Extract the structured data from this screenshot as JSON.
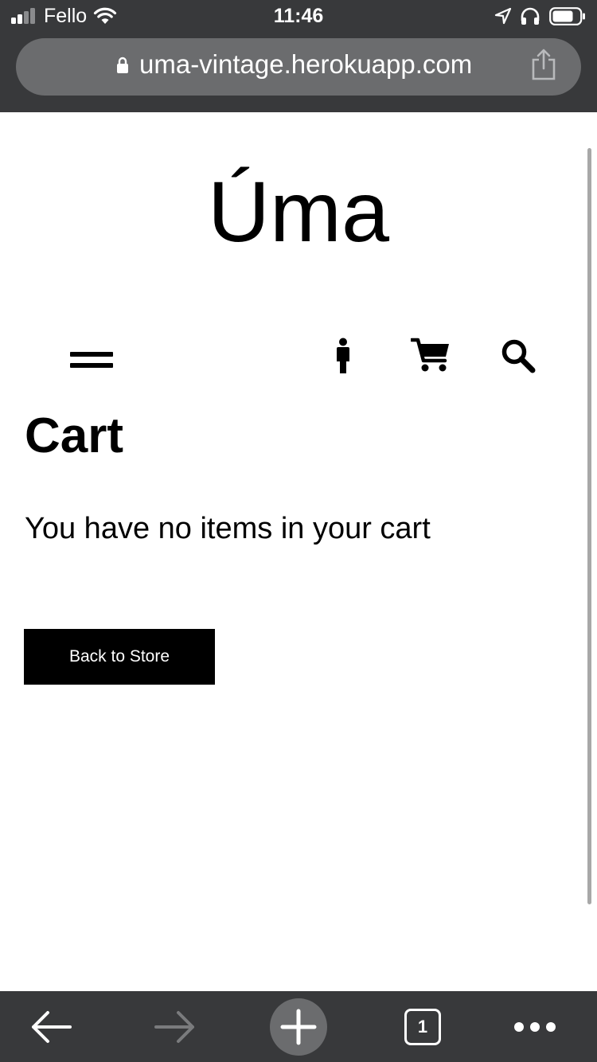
{
  "status_bar": {
    "carrier": "Fello",
    "time": "11:46"
  },
  "browser": {
    "url": "uma-vintage.herokuapp.com",
    "tab_count": "1"
  },
  "site": {
    "title": "Úma"
  },
  "nav_icons": [
    "menu-icon",
    "person-icon",
    "cart-icon",
    "search-icon"
  ],
  "page": {
    "heading": "Cart",
    "empty_message": "You have no items in your cart",
    "back_button_label": "Back to Store"
  },
  "colors": {
    "chrome": "#38393b",
    "address_bar": "#6b6c6e",
    "text": "#000000",
    "button_bg": "#000000",
    "button_text": "#ffffff"
  }
}
